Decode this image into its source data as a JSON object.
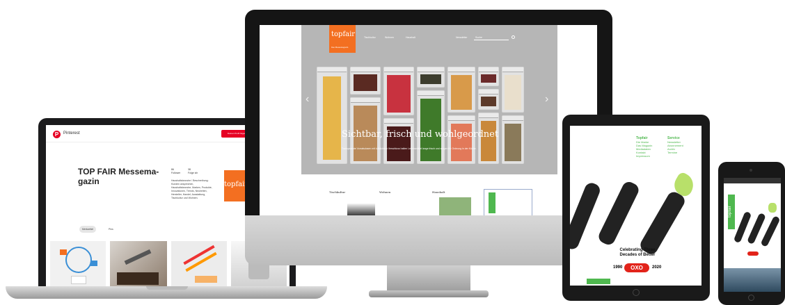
{
  "laptop": {
    "brand": "Pinterest",
    "pin_button_label": "Deinen Profil folgen",
    "profile_title": "TOP FAIR Messema-gazin",
    "stats": [
      {
        "value": "86",
        "label": "Follower"
      },
      {
        "value": "38",
        "label": "Folge ich"
      }
    ],
    "description": "Haushaltsbranche / Beschreibung: Kunden ansprechen, Haushaltsbranche, Marken, Produkte, Innovationen, Trends, Neuheiten, Hersteller, Handel, Ausstattung, Tischkultur und Wohnen.",
    "logo_text": "topfair",
    "tabs": [
      "Merkzettel",
      "Pins"
    ]
  },
  "desktop": {
    "logo_text": "topfair",
    "logo_sub": "Das Messemagazin",
    "nav": [
      "Tischkultur",
      "Wohnen",
      "Haushalt"
    ],
    "nav_right": [
      "Newsletter",
      "Suche"
    ],
    "hero_title": "Sichtbar, frisch und wohlgeordnet",
    "hero_subtitle": "Transparente Vorratsdosen mit luftdichtem Verschluss halten Lebensmittel lange frisch und sorgen für Ordnung in der Küche.",
    "categories": [
      "Tischkultur",
      "Wohnen",
      "Haushalt"
    ]
  },
  "tablet": {
    "columns": [
      {
        "heading": "Topfair",
        "items": [
          "Die Marke",
          "Das Magazin",
          "Mediadaten",
          "Kontakt",
          "Impressum"
        ]
      },
      {
        "heading": "Service",
        "items": [
          "Newsletter",
          "Abonnement",
          "Archiv",
          "Termine"
        ]
      }
    ],
    "oxo_tagline": "Celebrating Three Decades of Better",
    "oxo_logo": "OXO",
    "year_start": "1990",
    "year_end": "2020"
  },
  "phone": {
    "logo_text": "topfair"
  },
  "colors": {
    "brand_orange": "#f36f21",
    "pinterest_red": "#e60023",
    "oxo_red": "#e2231a",
    "green": "#4fb84f"
  }
}
